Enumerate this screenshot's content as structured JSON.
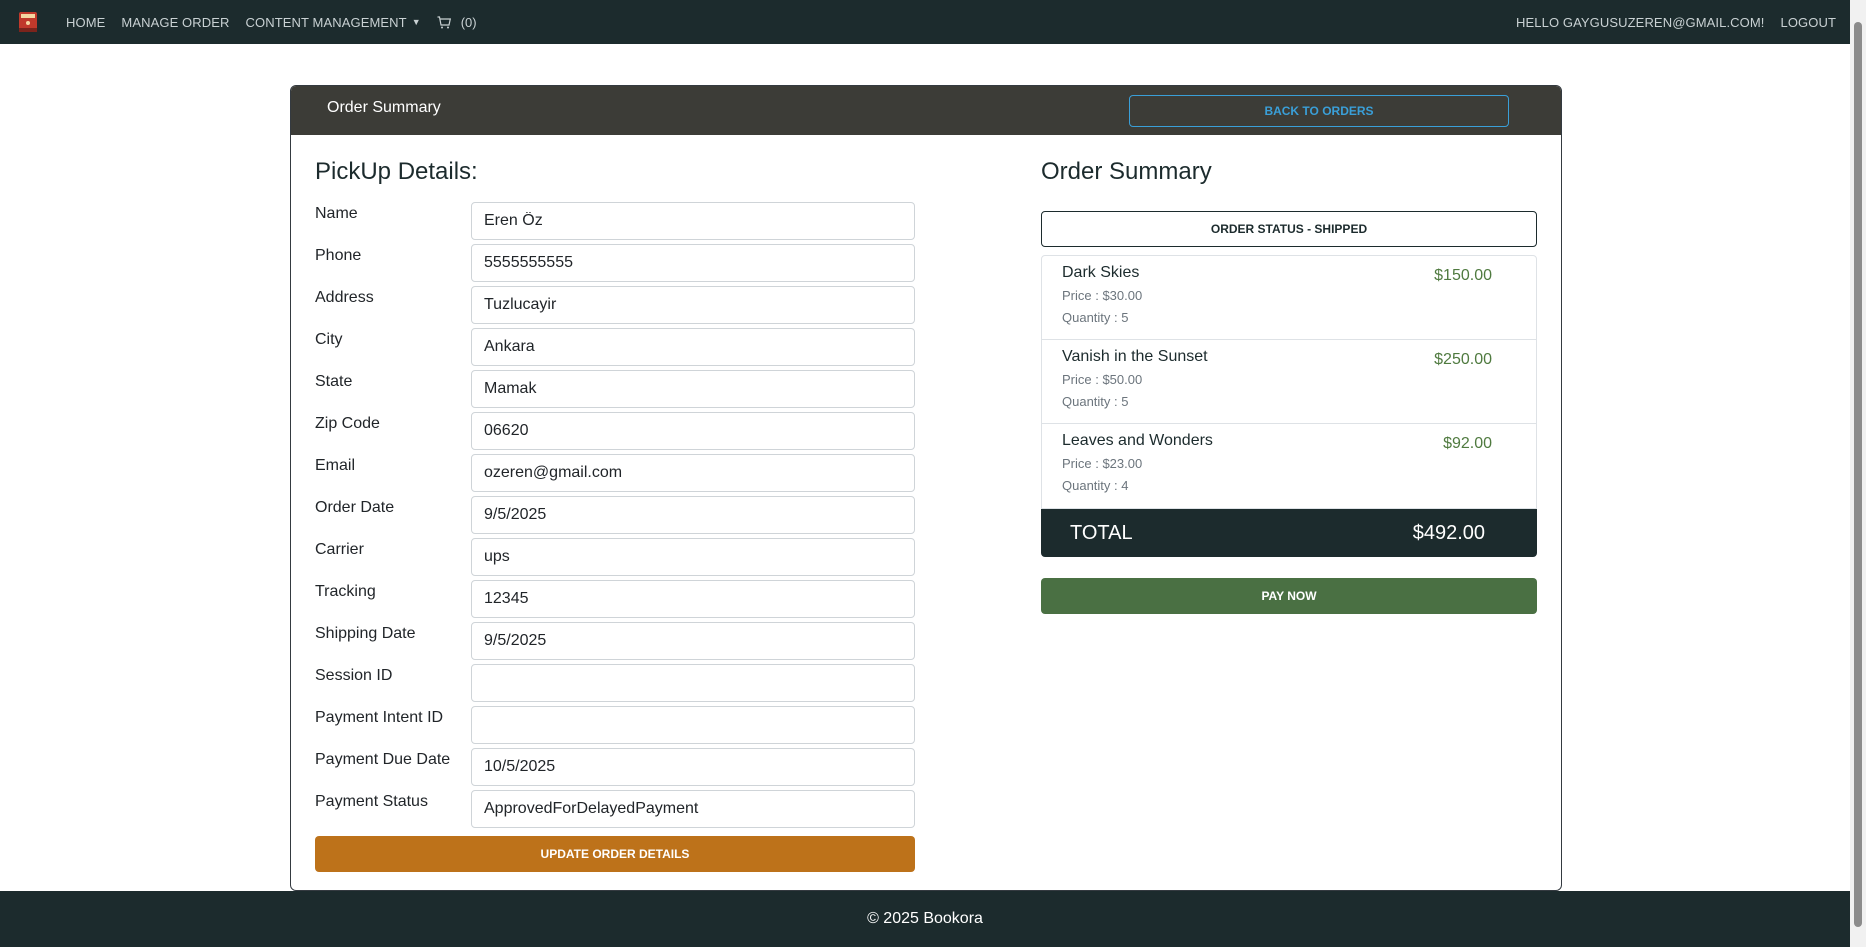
{
  "nav": {
    "logo_icon": "book-logo-icon",
    "home": "HOME",
    "manage_order": "MANAGE ORDER",
    "content_management": "CONTENT MANAGEMENT",
    "cart_count": "(0)",
    "greeting": "HELLO GAYGUSUZEREN@GMAIL.COM!",
    "logout": "LOGOUT"
  },
  "header": {
    "title": "Order Summary",
    "back_button": "BACK TO ORDERS"
  },
  "pickup": {
    "title": "PickUp Details:",
    "fields": [
      {
        "label": "Name",
        "value": "Eren Öz"
      },
      {
        "label": "Phone",
        "value": "5555555555"
      },
      {
        "label": "Address",
        "value": "Tuzlucayir"
      },
      {
        "label": "City",
        "value": "Ankara"
      },
      {
        "label": "State",
        "value": "Mamak"
      },
      {
        "label": "Zip Code",
        "value": "06620"
      },
      {
        "label": "Email",
        "value": "ozeren@gmail.com"
      },
      {
        "label": "Order Date",
        "value": "9/5/2025"
      },
      {
        "label": "Carrier",
        "value": "ups"
      },
      {
        "label": "Tracking",
        "value": "12345"
      },
      {
        "label": "Shipping Date",
        "value": "9/5/2025"
      },
      {
        "label": "Session ID",
        "value": ""
      },
      {
        "label": "Payment Intent ID",
        "value": ""
      },
      {
        "label": "Payment Due Date",
        "value": "10/5/2025"
      },
      {
        "label": "Payment Status",
        "value": "ApprovedForDelayedPayment"
      }
    ],
    "update_button": "UPDATE ORDER DETAILS"
  },
  "summary": {
    "title": "Order Summary",
    "status": "ORDER STATUS - SHIPPED",
    "items": [
      {
        "name": "Dark Skies",
        "price": "Price : $30.00",
        "quantity": "Quantity : 5",
        "total": "$150.00"
      },
      {
        "name": "Vanish in the Sunset",
        "price": "Price : $50.00",
        "quantity": "Quantity : 5",
        "total": "$250.00"
      },
      {
        "name": "Leaves and Wonders",
        "price": "Price : $23.00",
        "quantity": "Quantity : 4",
        "total": "$92.00"
      }
    ],
    "total_label": "TOTAL",
    "total_value": "$492.00",
    "pay_button": "PAY NOW"
  },
  "footer": {
    "text": "© 2025 Bookora"
  },
  "colors": {
    "navbar": "#1c2b2d",
    "card_header": "#3c3c37",
    "accent_blue": "#3a9fd8",
    "update_button": "#bd721a",
    "pay_button": "#4a7043",
    "item_total": "#4f7a3f"
  }
}
